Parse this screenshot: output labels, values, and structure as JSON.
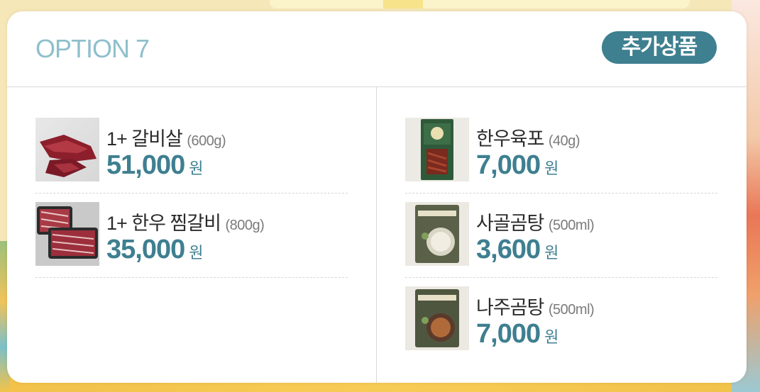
{
  "option": {
    "title": "OPTION 7"
  },
  "badge": {
    "label": "추가상품"
  },
  "left_items": [
    {
      "name": "1+ 갈비살",
      "qty": "(600g)",
      "price": "51,000",
      "unit": "원",
      "thumb": "beef-rib-meat"
    },
    {
      "name": "1+ 한우 찜갈비",
      "qty": "(800g)",
      "price": "35,000",
      "unit": "원",
      "thumb": "braised-short-ribs"
    }
  ],
  "right_items": [
    {
      "name": "한우육포",
      "qty": "(40g)",
      "price": "7,000",
      "unit": "원",
      "thumb": "beef-jerky-package"
    },
    {
      "name": "사골곰탕",
      "qty": "(500ml)",
      "price": "3,600",
      "unit": "원",
      "thumb": "bone-soup-pouch"
    },
    {
      "name": "나주곰탕",
      "qty": "(500ml)",
      "price": "7,000",
      "unit": "원",
      "thumb": "naju-soup-pouch"
    }
  ],
  "colors": {
    "accent": "#3e7f90",
    "title": "#8ebfcc",
    "text": "#2b2b2b"
  }
}
